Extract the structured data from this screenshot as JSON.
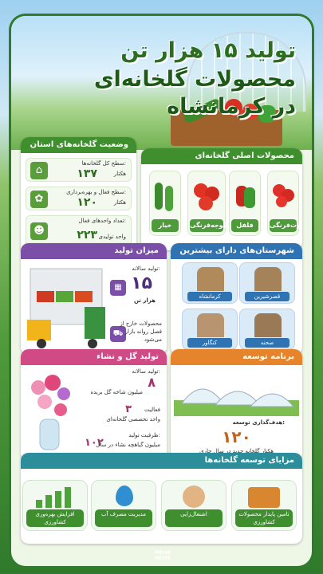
{
  "header": {
    "line1": "تولید ۱۵ هزار تن",
    "line2": "محصولات گلخانه‌ای",
    "line3": "در کرمانشاه"
  },
  "status": {
    "title": "وضعیت گلخانه‌های استان",
    "rows": [
      {
        "label": "سطح کل گلخانه‌ها:",
        "value": "۱۳۷",
        "unit": "هکتار"
      },
      {
        "label": "سطح فعال و بهره‌برداری:",
        "value": "۱۲۰",
        "unit": "هکتار"
      },
      {
        "label": "تعداد واحدهای فعال:",
        "value": "۲۲۳",
        "unit": "واحد تولیدی"
      }
    ]
  },
  "products": {
    "title": "محصولات اصلی گلخانه‌ای",
    "items": [
      "توت‌فرنگی",
      "فلفل",
      "گوجه‌فرنگی",
      "خیار"
    ]
  },
  "production": {
    "title": "میزان تولید",
    "annual_label": "تولید سالانه:",
    "annual_value": "۱۵",
    "annual_unit": "هزار تن",
    "note": "محصولات خارج از فصل روانه بازار می‌شود"
  },
  "cities": {
    "title": "شهرستان‌های دارای بیشترین گلخانه",
    "items": [
      "کرمانشاه",
      "قصرشیرین",
      "کنگاور",
      "صحنه"
    ]
  },
  "flowers": {
    "title": "تولید گل و نشاء",
    "rows": [
      {
        "label": "تولید سالانه:",
        "value": "۸",
        "unit": "میلیون شاخه گل بریده"
      },
      {
        "label": "فعالیت",
        "value": "۳",
        "unit": "واحد تخصصی گلخانه‌ای"
      },
      {
        "label": "ظرفیت تولید:",
        "value": "۱۰۲",
        "unit": "میلیون گیاهچه نشاء در سال"
      }
    ]
  },
  "development": {
    "title": "برنامه توسعه",
    "target_label": "هدف‌گذاری توسعه:",
    "target_value": "۱۲۰",
    "target_unit": "هکتار گلخانه جدید در سال جاری"
  },
  "advantages": {
    "title": "مزایای توسعه گلخانه‌ها",
    "items": [
      "تامین پایدار محصولات کشاورزی",
      "اشتغال‌زایی",
      "مدیریت مصرف آب",
      "افزایش بهره‌وری کشاورزی"
    ]
  },
  "logo": {
    "line1": "MEHR",
    "line2": "NEWS"
  },
  "colors": {
    "green": "#3f8f2f",
    "purple": "#7b4fa8",
    "blue": "#2f73b3",
    "pink": "#d04b86",
    "orange": "#e6842c",
    "teal": "#2c8e9a"
  }
}
